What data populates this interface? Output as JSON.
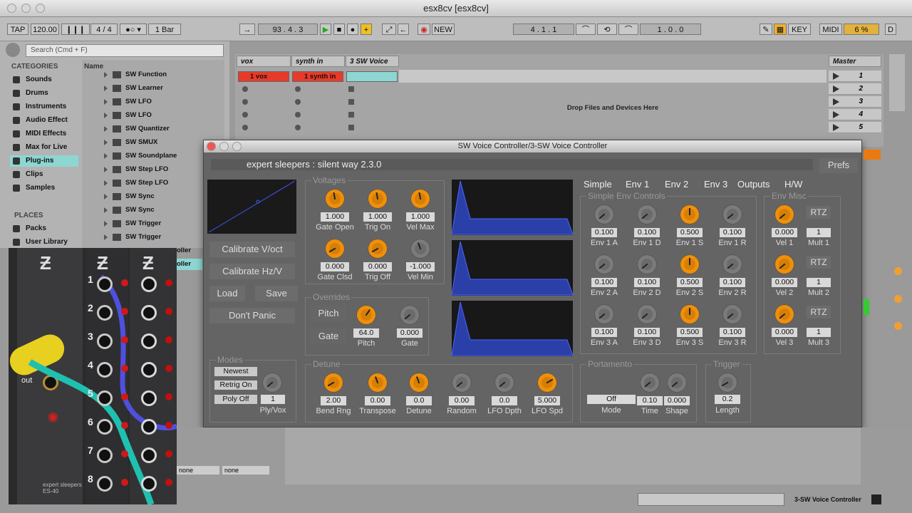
{
  "window": {
    "title": "esx8cv  [esx8cv]"
  },
  "transport": {
    "tap": "TAP",
    "bpm": "120.00",
    "meter": "4 / 4",
    "quant": "1 Bar",
    "pos": "93 .  4 .  3",
    "new": "NEW",
    "loop_start": "4 .  1 .  1",
    "loop_len": "1 .  0 .  0",
    "key": "KEY",
    "midi": "MIDI",
    "cpu": "6 %",
    "d": "D"
  },
  "browser": {
    "search_placeholder": "Search (Cmd + F)",
    "categories_title": "CATEGORIES",
    "name_col": "Name",
    "places_title": "PLACES",
    "categories": [
      "Sounds",
      "Drums",
      "Instruments",
      "Audio Effect",
      "MIDI Effects",
      "Max for Live",
      "Plug-ins",
      "Clips",
      "Samples"
    ],
    "places": [
      "Packs",
      "User Library"
    ],
    "items": [
      "SW Function",
      "SW Learner",
      "SW LFO",
      "SW LFO",
      "SW Quantizer",
      "SW SMUX",
      "SW Soundplane",
      "SW Step LFO",
      "SW Step LFO",
      "SW Sync",
      "SW Sync",
      "SW Trigger",
      "SW Trigger"
    ],
    "side_labels": [
      "oller",
      "oller"
    ]
  },
  "session": {
    "tracks": [
      "vox",
      "synth in",
      "3 SW Voice"
    ],
    "clips": [
      "1 vox",
      "1 synth in"
    ],
    "drop_text": "Drop Files and Devices Here",
    "master": "Master",
    "scenes": [
      "1",
      "2",
      "3",
      "4",
      "5"
    ]
  },
  "plugin": {
    "window_title": "SW Voice Controller/3-SW Voice Controller",
    "brand": "expert sleepers : silent way 2.3.0",
    "prefs": "Prefs",
    "buttons": [
      "Calibrate V/oct",
      "Calibrate Hz/V",
      "Load",
      "Save",
      "Don't Panic"
    ],
    "tabs": [
      "Simple",
      "Env 1",
      "Env 2",
      "Env 3",
      "Outputs",
      "H/W"
    ],
    "voltages": {
      "title": "Voltages",
      "knobs": [
        {
          "value": "1.000",
          "label": "Gate Open"
        },
        {
          "value": "1.000",
          "label": "Trig On"
        },
        {
          "value": "1.000",
          "label": "Vel Max"
        },
        {
          "value": "0.000",
          "label": "Gate Clsd"
        },
        {
          "value": "0.000",
          "label": "Trig Off"
        },
        {
          "value": "-1.000",
          "label": "Vel Min"
        }
      ]
    },
    "overrides": {
      "title": "Overrides",
      "pitch_btn": "Pitch",
      "gate_btn": "Gate",
      "knobs": [
        {
          "value": "64.0",
          "label": "Pitch"
        },
        {
          "value": "0.000",
          "label": "Gate"
        }
      ]
    },
    "simple_env": {
      "title": "Simple Env Controls",
      "knobs": [
        {
          "value": "0.100",
          "label": "Env 1 A"
        },
        {
          "value": "0.100",
          "label": "Env 1 D"
        },
        {
          "value": "0.500",
          "label": "Env 1 S"
        },
        {
          "value": "0.100",
          "label": "Env 1 R"
        },
        {
          "value": "0.100",
          "label": "Env 2 A"
        },
        {
          "value": "0.100",
          "label": "Env 2 D"
        },
        {
          "value": "0.500",
          "label": "Env 2 S"
        },
        {
          "value": "0.100",
          "label": "Env 2 R"
        },
        {
          "value": "0.100",
          "label": "Env 3 A"
        },
        {
          "value": "0.100",
          "label": "Env 3 D"
        },
        {
          "value": "0.500",
          "label": "Env 3 S"
        },
        {
          "value": "0.100",
          "label": "Env 3 R"
        }
      ]
    },
    "env_misc": {
      "title": "Env Misc",
      "rtz": "RTZ",
      "rows": [
        {
          "vel_value": "0.000",
          "vel_label": "Vel 1",
          "mult_value": "1",
          "mult_label": "Mult 1"
        },
        {
          "vel_value": "0.000",
          "vel_label": "Vel 2",
          "mult_value": "1",
          "mult_label": "Mult 2"
        },
        {
          "vel_value": "0.000",
          "vel_label": "Vel 3",
          "mult_value": "1",
          "mult_label": "Mult 3"
        }
      ]
    },
    "modes": {
      "title": "Modes",
      "options": [
        "Newest",
        "Retrig On",
        "Poly Off"
      ],
      "ply_value": "1",
      "ply_label": "Ply/Vox"
    },
    "detune": {
      "title": "Detune",
      "knobs": [
        {
          "value": "2.00",
          "label": "Bend Rng"
        },
        {
          "value": "0.00",
          "label": "Transpose"
        },
        {
          "value": "0.0",
          "label": "Detune"
        },
        {
          "value": "0.00",
          "label": "Random"
        },
        {
          "value": "0.0",
          "label": "LFO Dpth"
        },
        {
          "value": "5.000",
          "label": "LFO Spd"
        }
      ]
    },
    "portamento": {
      "title": "Portamento",
      "mode_value": "Off",
      "mode_label": "Mode",
      "knobs": [
        {
          "value": "0.10",
          "label": "Time"
        },
        {
          "value": "0.000",
          "label": "Shape"
        }
      ]
    },
    "trigger": {
      "title": "Trigger",
      "value": "0.2",
      "label": "Length"
    }
  },
  "bottom": {
    "device_name": "3-SW Voice Controller",
    "none1": "none",
    "none2": "none"
  },
  "video": {
    "jacks": [
      "1",
      "2",
      "3",
      "4",
      "5",
      "6",
      "7",
      "8"
    ],
    "out": "out",
    "brand": "expert sleepers ES-40"
  }
}
